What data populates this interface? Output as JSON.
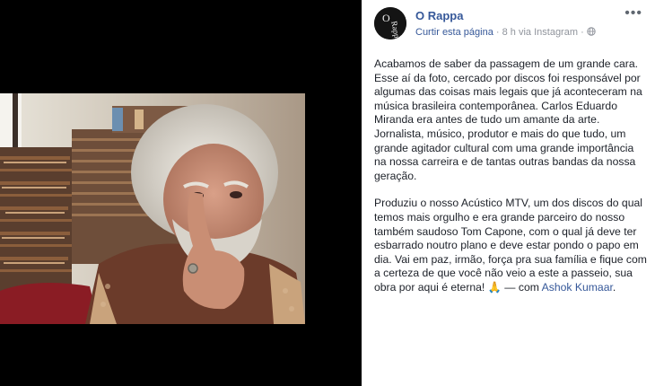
{
  "post": {
    "page_name": "O Rappa",
    "avatar_logo_text": "O Rappa",
    "like_page_label": "Curtir esta página",
    "separator": "·",
    "time_text": "8 h via Instagram",
    "audience_icon": "globe-icon",
    "more_label": "•••",
    "paragraph_1": "Acabamos de saber da passagem de um grande cara. Esse aí da foto, cercado por discos foi responsável por algumas das coisas mais legais que já aconteceram na música brasileira contemporânea. Carlos Eduardo Miranda era antes de tudo um amante da arte. Jornalista, músico, produtor e mais do que tudo, um grande agitador cultural com uma grande importância na nossa carreira e de tantas outras bandas da nossa geração.",
    "paragraph_2": "Produziu o nosso Acústico MTV, um dos discos do qual temos mais orgulho e era grande parceiro do nosso também saudoso Tom Capone, com o qual já deve ter esbarrado noutro plano e deve estar pondo o papo em dia. Vai em paz, irmão, força pra sua família e fique com a certeza de que você não veio a este a passeio, sua obra por aqui é eterna!",
    "emoji": "🙏",
    "with_prefix": " — com ",
    "tagged_person": "Ashok Kumaar",
    "period": "."
  },
  "colors": {
    "link": "#365899",
    "meta": "#90949c",
    "text": "#1d2129",
    "background": "#000000"
  }
}
